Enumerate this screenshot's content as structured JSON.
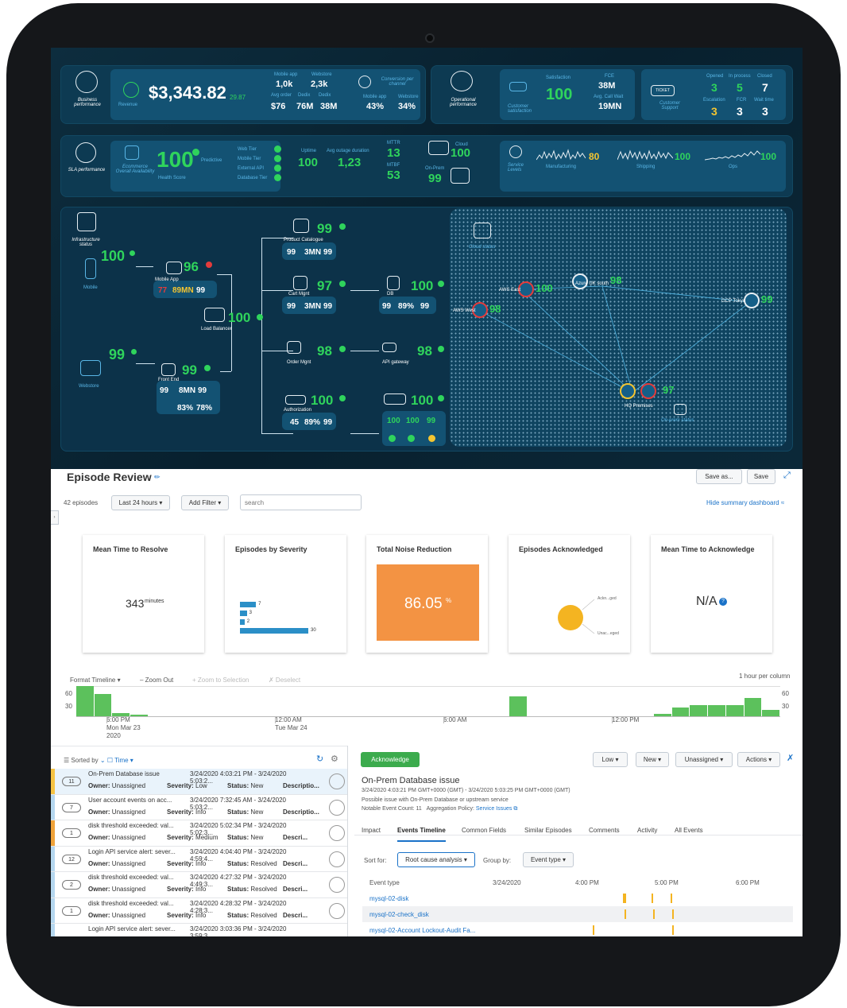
{
  "business": {
    "label": "Business performance",
    "revenue_label": "Revenue",
    "revenue": "$3,343.82",
    "revenue_delta": "29.87",
    "channel_head": [
      "Mobile app",
      "Webstore"
    ],
    "row1": [
      "1,0k",
      "2,3k"
    ],
    "row1_sub": [
      "Avg order",
      "Dedix",
      "Dedix"
    ],
    "row2": [
      "$76",
      "76M",
      "38M"
    ],
    "conv_label": "Conversion per channel",
    "conv_heads": [
      "Mobile app",
      "Webstore"
    ],
    "conv_vals": [
      "43%",
      "34%"
    ]
  },
  "operational": {
    "label": "Operational performance",
    "cs_label": "Customer satisfaction",
    "sat_label": "Satisfaction",
    "sat_value": "100",
    "fce_label": "FCE",
    "fce_value": "38M",
    "acw_label": "Avg. Call Wait",
    "acw_value": "19MN",
    "support_label": "Customer Support",
    "ticket_label": "TICKET",
    "heads1": [
      "Opened",
      "In process",
      "Closed"
    ],
    "vals1": [
      "3",
      "5",
      "7"
    ],
    "heads2": [
      "Escalation",
      "FCR",
      "Wait time"
    ],
    "vals2": [
      "3",
      "3",
      "3"
    ]
  },
  "sla": {
    "label": "SLA performance",
    "eco_label": "Ecommerce Overall Availability",
    "eco_value": "100",
    "predictive": "Predictive",
    "health_score": "Health Score",
    "tiers": [
      "Web Tier",
      "Mobile Tier",
      "External API",
      "Database Tier"
    ],
    "uptime_label": "Uptime",
    "uptime_value": "100",
    "outage_label": "Avg outage duration",
    "outage_value": "1,23",
    "mttr_label": "MTTR",
    "mttr_value": "13",
    "mtbf_label": "MTBF",
    "mtbf_value": "53",
    "cloud_label": "Cloud",
    "cloud_value": "100",
    "onprem_label": "On-Prem",
    "onprem_value": "99"
  },
  "service_levels": {
    "label": "Service Levels",
    "items": [
      {
        "name": "Manufacturing",
        "value": "80"
      },
      {
        "name": "Shipping",
        "value": "100"
      },
      {
        "name": "Ops",
        "value": "100"
      }
    ]
  },
  "infra": {
    "label": "Infrastructure status",
    "cloud_status": "Cloud status",
    "onprem_status": "On-prem status",
    "mobile": {
      "name": "Mobile",
      "value": "100"
    },
    "webstore": {
      "name": "Webstore",
      "value": "99"
    },
    "mobile_app": {
      "name": "Mobile App",
      "value": "96",
      "a": "77",
      "b": "89MN",
      "c": "99"
    },
    "front_end": {
      "name": "Front End",
      "value": "99",
      "a": "99",
      "b": "8MN",
      "c": "99",
      "d": "83%",
      "e": "78%"
    },
    "load_balancer": {
      "name": "Load Balancer",
      "value": "100"
    },
    "catalogue": {
      "name": "Product Catalogue",
      "value": "99",
      "a": "99",
      "b": "3MN",
      "c": "99"
    },
    "cart": {
      "name": "Cart Mgnt",
      "value": "97",
      "a": "99",
      "b": "3MN",
      "c": "99"
    },
    "order": {
      "name": "Order Mgnt",
      "value": "98"
    },
    "auth": {
      "name": "Authorization",
      "value": "100",
      "a": "45",
      "b": "89%",
      "c": "99"
    },
    "db": {
      "name": "DB",
      "value": "100",
      "a": "99",
      "b": "89%",
      "c": "99"
    },
    "api": {
      "name": "API gateway",
      "value": "98"
    },
    "dc": {
      "value": "100",
      "a": "100",
      "b": "100",
      "c": "99"
    },
    "regions": [
      "AWS East",
      "Azure UK south",
      "AWS West",
      "GCP Tokyo",
      "HQ Premises"
    ],
    "region_vals": [
      "100",
      "98",
      "98",
      "99",
      "97"
    ]
  },
  "review": {
    "title": "Episode Review",
    "save_as": "Save as...",
    "save": "Save",
    "episodes": "42 episodes",
    "time_range": "Last 24 hours",
    "add_filter": "Add Filter",
    "search_placeholder": "search",
    "hide_summary": "Hide summary dashboard",
    "cards": {
      "mttr_title": "Mean Time to Resolve",
      "mttr_value": "343",
      "mttr_unit": "minutes",
      "sev_title": "Episodes by Severity",
      "sev_values": [
        "7",
        "3",
        "2",
        "30"
      ],
      "noise_title": "Total Noise Reduction",
      "noise_value": "86.05",
      "noise_unit": "%",
      "ack_title": "Episodes Acknowledged",
      "ack_labels": [
        "Ackn...ged",
        "Unac...eged"
      ],
      "mtta_title": "Mean Time to Acknowledge",
      "mtta_value": "N/A"
    },
    "timeline": {
      "format": "Format Timeline",
      "zoom_out": "– Zoom Out",
      "zoom_sel": "+ Zoom to Selection",
      "deselect": "✗ Deselect",
      "per_col": "1 hour per column",
      "y_top": "60",
      "y_bot": "30",
      "labels": [
        {
          "t": "6:00 PM",
          "d": "Mon Mar 23",
          "y": "2020"
        },
        {
          "t": "12:00 AM",
          "d": "Tue Mar 24",
          "y": ""
        },
        {
          "t": "6:00 AM",
          "d": "",
          "y": ""
        },
        {
          "t": "12:00 PM",
          "d": "",
          "y": ""
        }
      ],
      "bars": [
        68,
        50,
        8,
        4,
        0,
        0,
        0,
        0,
        0,
        0,
        0,
        0,
        0,
        0,
        0,
        0,
        0,
        0,
        0,
        0,
        0,
        0,
        0,
        0,
        45,
        0,
        0,
        0,
        0,
        0,
        0,
        0,
        6,
        20,
        26,
        26,
        26,
        42,
        14
      ]
    },
    "list": {
      "sorted_by": "Sorted by",
      "sort_field": "Time",
      "rows": [
        {
          "n": "11",
          "title": "On-Prem Database issue",
          "range": "3/24/2020 4:03:21 PM - 3/24/2020 5:03:2...",
          "owner": "Unassigned",
          "severity": "Low",
          "status": "New",
          "desc": "Descriptio...",
          "color": "#f6c343"
        },
        {
          "n": "7",
          "title": "User account events on acc...",
          "range": "3/24/2020 7:32:45 AM - 3/24/2020 5:03:2...",
          "owner": "Unassigned",
          "severity": "Info",
          "status": "New",
          "desc": "Descriptio...",
          "color": "#b5d7ef"
        },
        {
          "n": "1",
          "title": "disk threshold exceeded: val...",
          "range": "3/24/2020 5:02:34 PM - 3/24/2020 5:02:3...",
          "owner": "Unassigned",
          "severity": "Medium",
          "status": "New",
          "desc": "Descri...",
          "color": "#f0a33a"
        },
        {
          "n": "12",
          "title": "Login API service alert: sever...",
          "range": "3/24/2020 4:04:40 PM - 3/24/2020 4:59:4...",
          "owner": "Unassigned",
          "severity": "Info",
          "status": "Resolved",
          "desc": "Descri...",
          "color": "#b5d7ef"
        },
        {
          "n": "2",
          "title": "disk threshold exceeded: val...",
          "range": "3/24/2020 4:27:32 PM - 3/24/2020 4:49:3...",
          "owner": "Unassigned",
          "severity": "Info",
          "status": "Resolved",
          "desc": "Descri...",
          "color": "#b5d7ef"
        },
        {
          "n": "1",
          "title": "disk threshold exceeded: val...",
          "range": "3/24/2020 4:28:32 PM - 3/24/2020 4:28:3...",
          "owner": "Unassigned",
          "severity": "Info",
          "status": "Resolved",
          "desc": "Descri...",
          "color": "#b5d7ef"
        },
        {
          "n": "",
          "title": "Login API service alert: sever...",
          "range": "3/24/2020 3:03:36 PM - 3/24/2020 3:59:3...",
          "owner": "",
          "severity": "",
          "status": "",
          "desc": "",
          "color": "#b5d7ef"
        }
      ]
    },
    "detail": {
      "ack": "Acknowledge",
      "low": "Low",
      "new": "New",
      "unassigned": "Unassigned",
      "actions": "Actions",
      "title": "On-Prem Database issue",
      "range": "3/24/2020 4:03:21 PM GMT+0000 (GMT) - 3/24/2020 5:03:25 PM GMT+0000 (GMT)",
      "possible": "Possible issue with On-Prem Database or upstream service",
      "notable": "Notable Event Count: 11",
      "policy_label": "Aggregation Policy:",
      "policy": "Service Issues",
      "tabs": [
        "Impact",
        "Events Timeline",
        "Common Fields",
        "Similar Episodes",
        "Comments",
        "Activity",
        "All Events"
      ],
      "sort_for": "Sort for:",
      "root_cause": "Root cause analysis",
      "group_by": "Group by:",
      "event_type_btn": "Event type",
      "cols": [
        "Event type",
        "3/24/2020",
        "4:00 PM",
        "5:00 PM",
        "6:00 PM"
      ],
      "events": [
        "mysql-02-disk",
        "mysql-02-check_disk",
        "mysql-02-Account Lockout-Audit Fa..."
      ]
    }
  }
}
